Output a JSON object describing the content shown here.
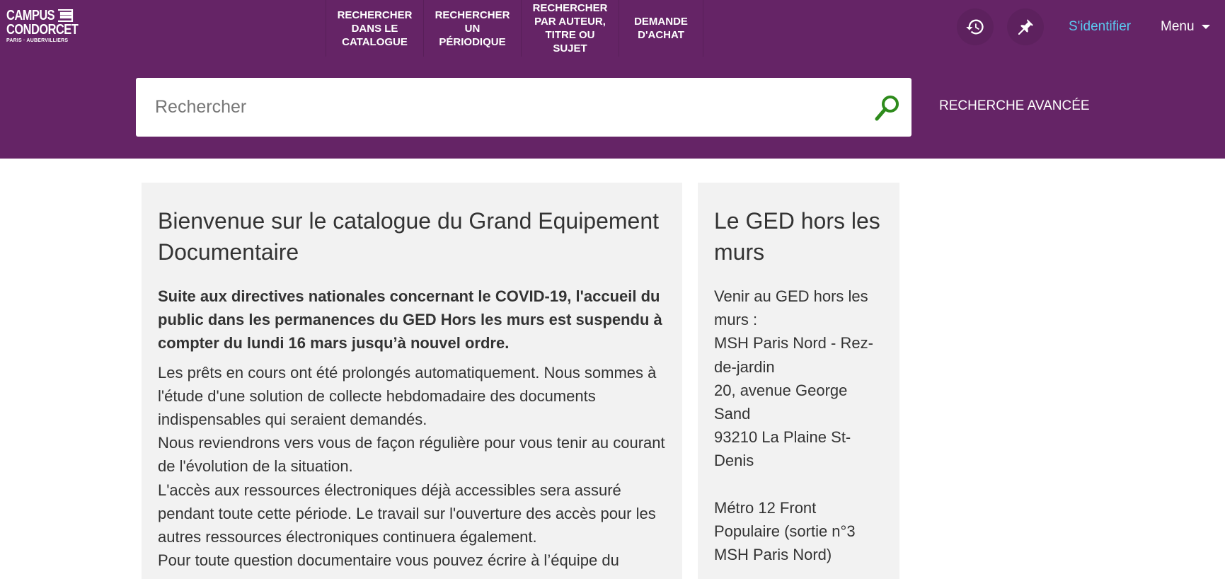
{
  "header": {
    "logo": {
      "line1": "CAMPUS",
      "line2": "CONDORCET",
      "line3": "PARIS · AUBERVILLIERS"
    },
    "nav": [
      {
        "name": "nav-search-catalogue",
        "lines": [
          "RECHERCHER",
          "DANS LE",
          "CATALOGUE"
        ]
      },
      {
        "name": "nav-search-periodical",
        "lines": [
          "RECHERCHER",
          "UN",
          "PÉRIODIQUE"
        ]
      },
      {
        "name": "nav-search-author",
        "lines": [
          "RECHERCHER",
          "PAR AUTEUR,",
          "TITRE OU",
          "SUJET"
        ]
      },
      {
        "name": "nav-purchase-request",
        "lines": [
          "DEMANDE",
          "D'ACHAT"
        ]
      }
    ],
    "history_icon": "history-icon",
    "pin_icon": "pin-icon",
    "signin_label": "S'identifier",
    "menu_label": "Menu"
  },
  "search": {
    "placeholder": "Rechercher",
    "value": "",
    "icon": "search-icon",
    "advanced_label": "RECHERCHE AVANCÉE"
  },
  "main_panel": {
    "title": "Bienvenue sur le catalogue du Grand Equipement Documentaire",
    "bold_paragraph": "Suite aux directives nationales concernant le COVID-19, l'accueil du public dans les permanences du GED Hors les murs est suspendu à compter du lundi 16 mars jusqu’à nouvel ordre.",
    "paragraph_1": "Les prêts en cours ont été prolongés automatiquement. Nous sommes à l'étude d'une solution de collecte hebdomadaire des documents indispensables qui seraient demandés.",
    "paragraph_2": "Nous reviendrons vers vous de façon régulière pour vous tenir au courant de l'évolution de la situation.",
    "paragraph_3": "L'accès aux ressources électroniques déjà accessibles sera assuré pendant toute cette période. Le travail sur l'ouverture des accès pour les autres ressources électroniques continuera également.",
    "paragraph_4": "Pour toute question documentaire vous pouvez écrire à l’équipe du"
  },
  "side_panel": {
    "title": "Le GED hors les murs",
    "text_1": "Venir au GED hors les murs :\nMSH Paris Nord - Rez-de-jardin\n20, avenue George Sand\n93210 La Plaine St-Denis",
    "text_2": "Métro 12 Front Populaire (sortie n°3 MSH Paris Nord)"
  },
  "colors": {
    "header_bg": "#652466",
    "signin": "#5bc8ef",
    "search_icon": "#2e8b1c",
    "panel_bg": "#f2f2f2",
    "text": "#333333"
  }
}
